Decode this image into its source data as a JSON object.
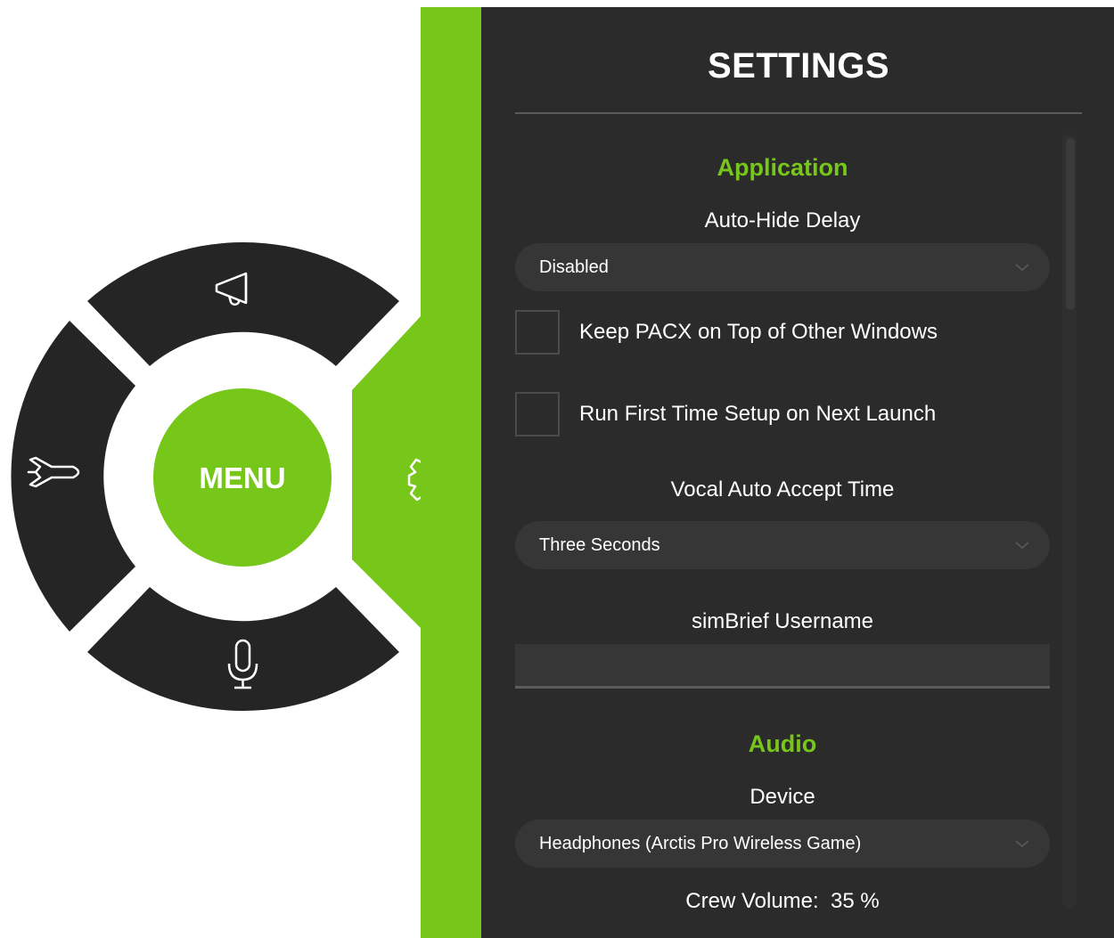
{
  "colors": {
    "accent": "#77c61a",
    "panel": "#2b2b2b",
    "control": "#363636",
    "segment": "#252525"
  },
  "menu": {
    "center_label": "MENU",
    "segments": [
      {
        "name": "announcements",
        "icon": "megaphone-icon"
      },
      {
        "name": "flight",
        "icon": "airplane-icon"
      },
      {
        "name": "voice",
        "icon": "microphone-icon"
      },
      {
        "name": "settings",
        "icon": "gear-icon"
      }
    ]
  },
  "settings": {
    "title": "SETTINGS",
    "application": {
      "heading": "Application",
      "auto_hide_label": "Auto-Hide Delay",
      "auto_hide_value": "Disabled",
      "keep_on_top_label": "Keep PACX on Top of Other Windows",
      "keep_on_top_checked": false,
      "first_time_label": "Run First Time Setup on Next Launch",
      "first_time_checked": false,
      "vocal_accept_label": "Vocal Auto Accept Time",
      "vocal_accept_value": "Three Seconds",
      "simbrief_label": "simBrief Username",
      "simbrief_value": ""
    },
    "audio": {
      "heading": "Audio",
      "device_label": "Device",
      "device_value": "Headphones (Arctis Pro Wireless Game)",
      "crew_volume_label": "Crew Volume:  35 %"
    }
  }
}
